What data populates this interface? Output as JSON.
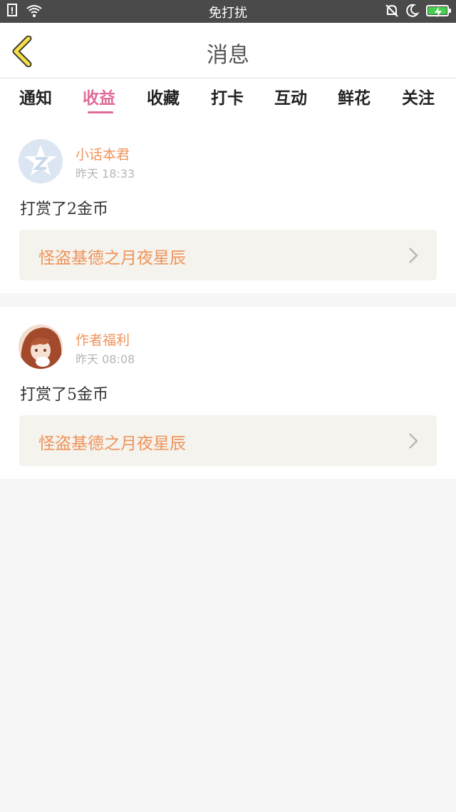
{
  "statusbar": {
    "center": "免打扰"
  },
  "header": {
    "title": "消息"
  },
  "tabs": [
    {
      "label": "通知",
      "active": false
    },
    {
      "label": "收益",
      "active": true
    },
    {
      "label": "收藏",
      "active": false
    },
    {
      "label": "打卡",
      "active": false
    },
    {
      "label": "互动",
      "active": false
    },
    {
      "label": "鲜花",
      "active": false
    },
    {
      "label": "关注",
      "active": false
    }
  ],
  "items": [
    {
      "username": "小话本君",
      "time": "昨天  18:33",
      "message": "打赏了2金币",
      "book": "怪盗基德之月夜星辰"
    },
    {
      "username": "作者福利",
      "time": "昨天  08:08",
      "message": "打赏了5金币",
      "book": "怪盗基德之月夜星辰"
    }
  ],
  "colors": {
    "accent": "#e06b9b",
    "name": "#f0935a",
    "book_bg": "#f4f3ed"
  }
}
